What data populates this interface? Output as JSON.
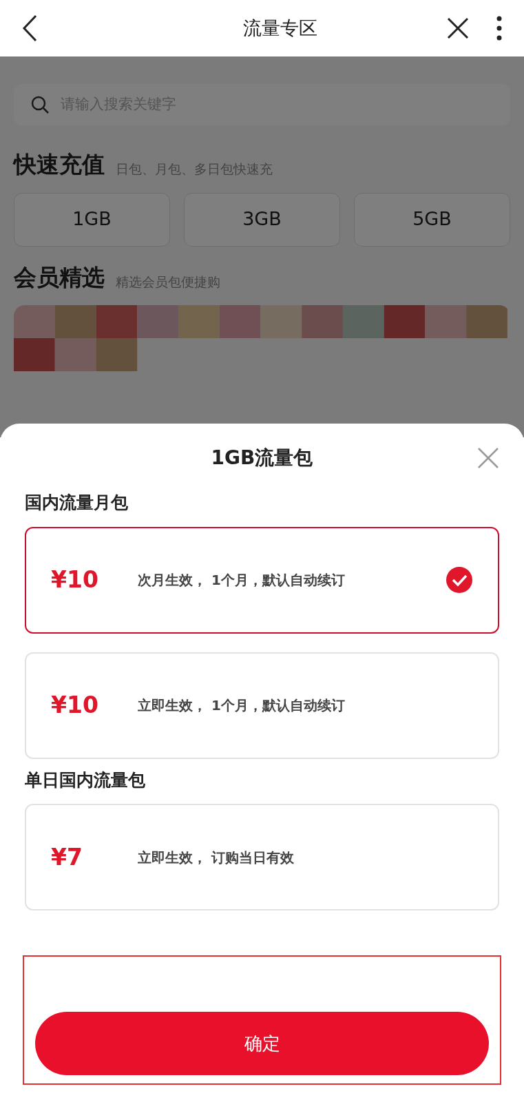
{
  "header": {
    "title": "流量专区"
  },
  "search": {
    "placeholder": "请输入搜索关键字"
  },
  "quick_recharge": {
    "title": "快速充值",
    "subtitle": "日包、月包、多日包快速充",
    "options": [
      "1GB",
      "3GB",
      "5GB"
    ]
  },
  "members": {
    "title": "会员精选",
    "subtitle": "精选会员包便捷购"
  },
  "sheet": {
    "title": "1GB流量包",
    "groups": [
      {
        "title": "国内流量月包",
        "plans": [
          {
            "price": "¥10",
            "description": "次月生效， 1个月，默认自动续订",
            "selected": true
          },
          {
            "price": "¥10",
            "description": "立即生效， 1个月，默认自动续订",
            "selected": false
          }
        ]
      },
      {
        "title": "单日国内流量包",
        "plans": [
          {
            "price": "¥7",
            "description": "立即生效， 订购当日有效",
            "selected": false
          }
        ]
      }
    ],
    "confirm_button": "确定"
  }
}
